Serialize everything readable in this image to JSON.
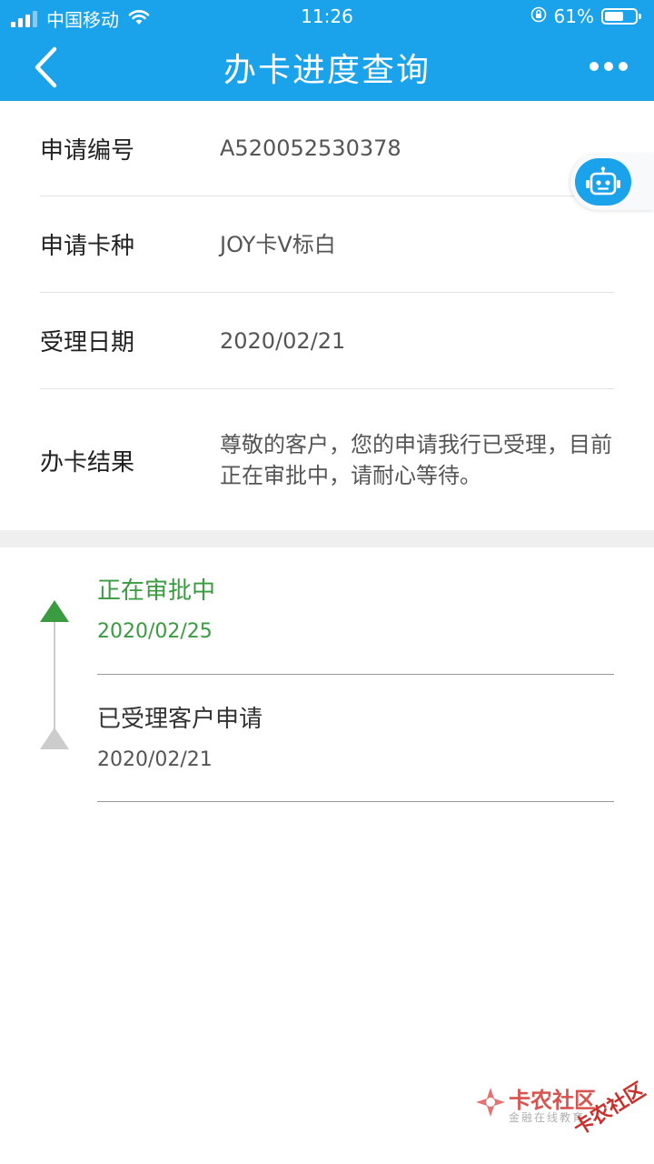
{
  "status_bar": {
    "carrier": "中国移动",
    "time": "11:26",
    "battery": "61%",
    "battery_level": 0.61
  },
  "nav": {
    "title": "办卡进度查询",
    "back_icon": "chevron-left-icon",
    "more_icon": "more-dots-icon"
  },
  "info": [
    {
      "label": "申请编号",
      "value": "A520052530378"
    },
    {
      "label": "申请卡种",
      "value": "JOY卡V标白"
    },
    {
      "label": "受理日期",
      "value": "2020/02/21"
    },
    {
      "label": "办卡结果",
      "value": "尊敬的客户，您的申请我行已受理，目前正在审批中，请耐心等待。"
    }
  ],
  "timeline": [
    {
      "title": "正在审批中",
      "date": "2020/02/25",
      "state": "active",
      "color": "#3a9b40"
    },
    {
      "title": "已受理客户申请",
      "date": "2020/02/21",
      "state": "done",
      "color": "#cccccc"
    }
  ],
  "robot": {
    "icon": "robot-icon"
  },
  "watermark": {
    "name": "卡农社区",
    "subtitle": "金融在线教育",
    "stamp": "卡农社区"
  },
  "colors": {
    "accent": "#1aa3ea",
    "status_green": "#3a9b40",
    "divider": "#efefef"
  }
}
